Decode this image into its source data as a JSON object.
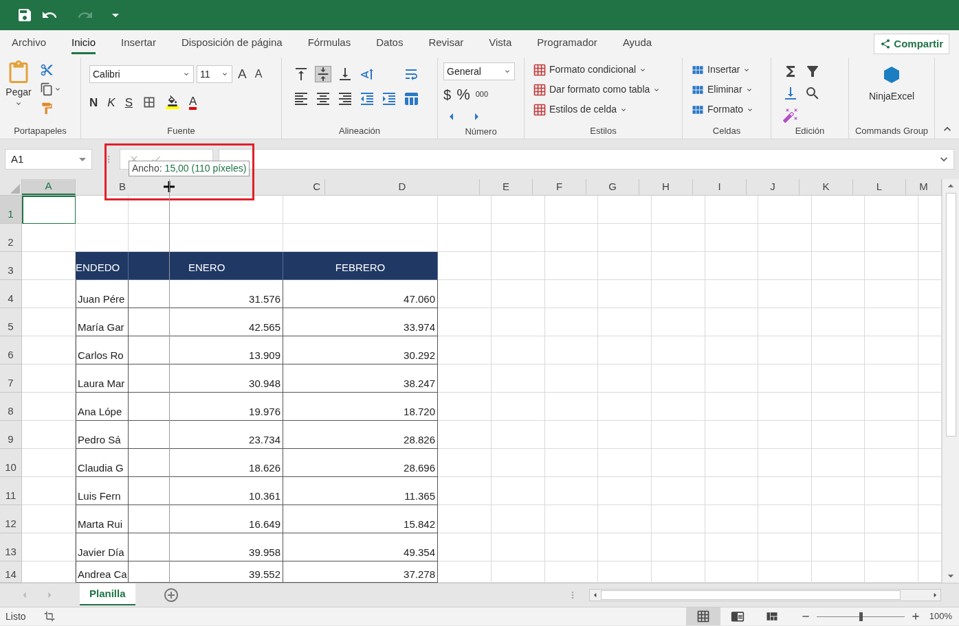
{
  "tabs": [
    {
      "label": "Archivo",
      "selected": false
    },
    {
      "label": "Inicio",
      "selected": true
    },
    {
      "label": "Insertar",
      "selected": false
    },
    {
      "label": "Disposición de página",
      "selected": false
    },
    {
      "label": "Fórmulas",
      "selected": false
    },
    {
      "label": "Datos",
      "selected": false
    },
    {
      "label": "Revisar",
      "selected": false
    },
    {
      "label": "Vista",
      "selected": false
    },
    {
      "label": "Programador",
      "selected": false
    },
    {
      "label": "Ayuda",
      "selected": false
    }
  ],
  "share_button": "Compartir",
  "ribbon": {
    "clipboard": {
      "paste": "Pegar",
      "label": "Portapapeles"
    },
    "font": {
      "name": "Calibri",
      "size": "11",
      "grow": "A",
      "shrink": "A",
      "styles": [
        "N",
        "K",
        "S"
      ],
      "color_letter": "A",
      "label": "Fuente"
    },
    "alignment": {
      "label": "Alineación"
    },
    "number": {
      "format": "General",
      "currency": "$",
      "percent": "%",
      "thousands": "000",
      "label": "Número"
    },
    "styles": {
      "buttons": [
        "Formato condicional",
        "Dar formato como tabla",
        "Estilos de celda"
      ],
      "label": "Estilos"
    },
    "cells": {
      "buttons": [
        "Insertar",
        "Eliminar",
        "Formato"
      ],
      "label": "Celdas"
    },
    "editing": {
      "label": "Edición"
    },
    "commands": {
      "button": "NinjaExcel",
      "label": "Commands Group"
    }
  },
  "name_box": "A1",
  "tooltip": {
    "label": "Ancho:",
    "value": "15,00 (110 píxeles)"
  },
  "columns": [
    {
      "label": "A",
      "selected": true
    },
    {
      "label": "B",
      "selected": false
    },
    {
      "label": "C",
      "selected": false
    },
    {
      "label": "D",
      "selected": false
    },
    {
      "label": "E",
      "selected": false
    },
    {
      "label": "F",
      "selected": false
    },
    {
      "label": "G",
      "selected": false
    },
    {
      "label": "H",
      "selected": false
    },
    {
      "label": "I",
      "selected": false
    },
    {
      "label": "J",
      "selected": false
    },
    {
      "label": "K",
      "selected": false
    },
    {
      "label": "L",
      "selected": false
    },
    {
      "label": "M",
      "selected": false
    }
  ],
  "rows": [
    {
      "label": "1",
      "selected": true
    },
    {
      "label": "2",
      "selected": false
    },
    {
      "label": "3",
      "selected": false
    },
    {
      "label": "4",
      "selected": false
    },
    {
      "label": "5",
      "selected": false
    },
    {
      "label": "6",
      "selected": false
    },
    {
      "label": "7",
      "selected": false
    },
    {
      "label": "8",
      "selected": false
    },
    {
      "label": "9",
      "selected": false
    },
    {
      "label": "10",
      "selected": false
    },
    {
      "label": "11",
      "selected": false
    },
    {
      "label": "12",
      "selected": false
    },
    {
      "label": "13",
      "selected": false
    },
    {
      "label": "14",
      "selected": false
    }
  ],
  "table": {
    "header": [
      "ENDEDO",
      "ENERO",
      "FEBRERO"
    ],
    "rows": [
      [
        "Juan Pére",
        "31.576",
        "47.060"
      ],
      [
        "María Gar",
        "42.565",
        "33.974"
      ],
      [
        "Carlos Ro",
        "13.909",
        "30.292"
      ],
      [
        "Laura Mar",
        "30.948",
        "38.247"
      ],
      [
        "Ana Lópe",
        "19.976",
        "18.720"
      ],
      [
        "Pedro Sá",
        "23.734",
        "28.826"
      ],
      [
        "Claudia G",
        "18.626",
        "28.696"
      ],
      [
        "Luis Fern",
        "10.361",
        "11.365"
      ],
      [
        "Marta Rui",
        "16.649",
        "15.842"
      ],
      [
        "Javier Día",
        "39.958",
        "49.354"
      ],
      [
        "Andrea Ca",
        "39.552",
        "37.278"
      ]
    ]
  },
  "sheets": [
    {
      "label": "Planilla",
      "selected": true
    }
  ],
  "status": {
    "text": "Listo",
    "zoom": "100%",
    "zoom_slider": {
      "level": 0.5
    }
  },
  "views": [
    {
      "kind": "normal",
      "selected": true
    },
    {
      "kind": "page_layout",
      "selected": false
    },
    {
      "kind": "page_break",
      "selected": false
    }
  ]
}
